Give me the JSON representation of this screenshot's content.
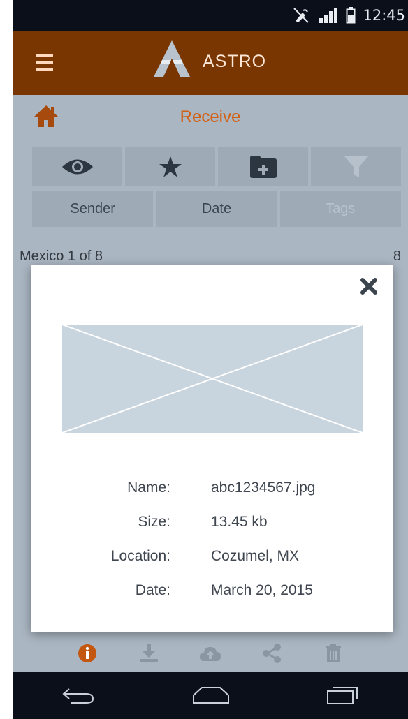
{
  "status_bar": {
    "time": "12:45",
    "icons": [
      "mute-icon",
      "signal-icon",
      "battery-icon"
    ]
  },
  "app_bar": {
    "title": "ASTRO",
    "menu_icon": "menu-icon",
    "logo": "astro-logo"
  },
  "page": {
    "title": "Receive"
  },
  "toolbar": {
    "buttons": [
      {
        "icon": "eye-icon"
      },
      {
        "icon": "star-icon"
      },
      {
        "icon": "folder-add-icon"
      },
      {
        "icon": "filter-icon",
        "disabled": true
      }
    ]
  },
  "sort": {
    "sender": "Sender",
    "date": "Date",
    "tags": "Tags"
  },
  "group": {
    "label": "Mexico 1 of 8",
    "count": "8"
  },
  "modal": {
    "details": [
      {
        "label": "Name:",
        "value": "abc1234567.jpg"
      },
      {
        "label": "Size:",
        "value": "13.45 kb"
      },
      {
        "label": "Location:",
        "value": "Cozumel, MX"
      },
      {
        "label": "Date:",
        "value": "March 20, 2015"
      }
    ]
  },
  "actions": [
    "info-icon",
    "download-icon",
    "cloud-upload-icon",
    "share-icon",
    "trash-icon"
  ],
  "colors": {
    "accent": "#d35f12",
    "app_bar": "#7a3600",
    "background": "#aab6c2",
    "system_bar": "#0b0f19"
  }
}
